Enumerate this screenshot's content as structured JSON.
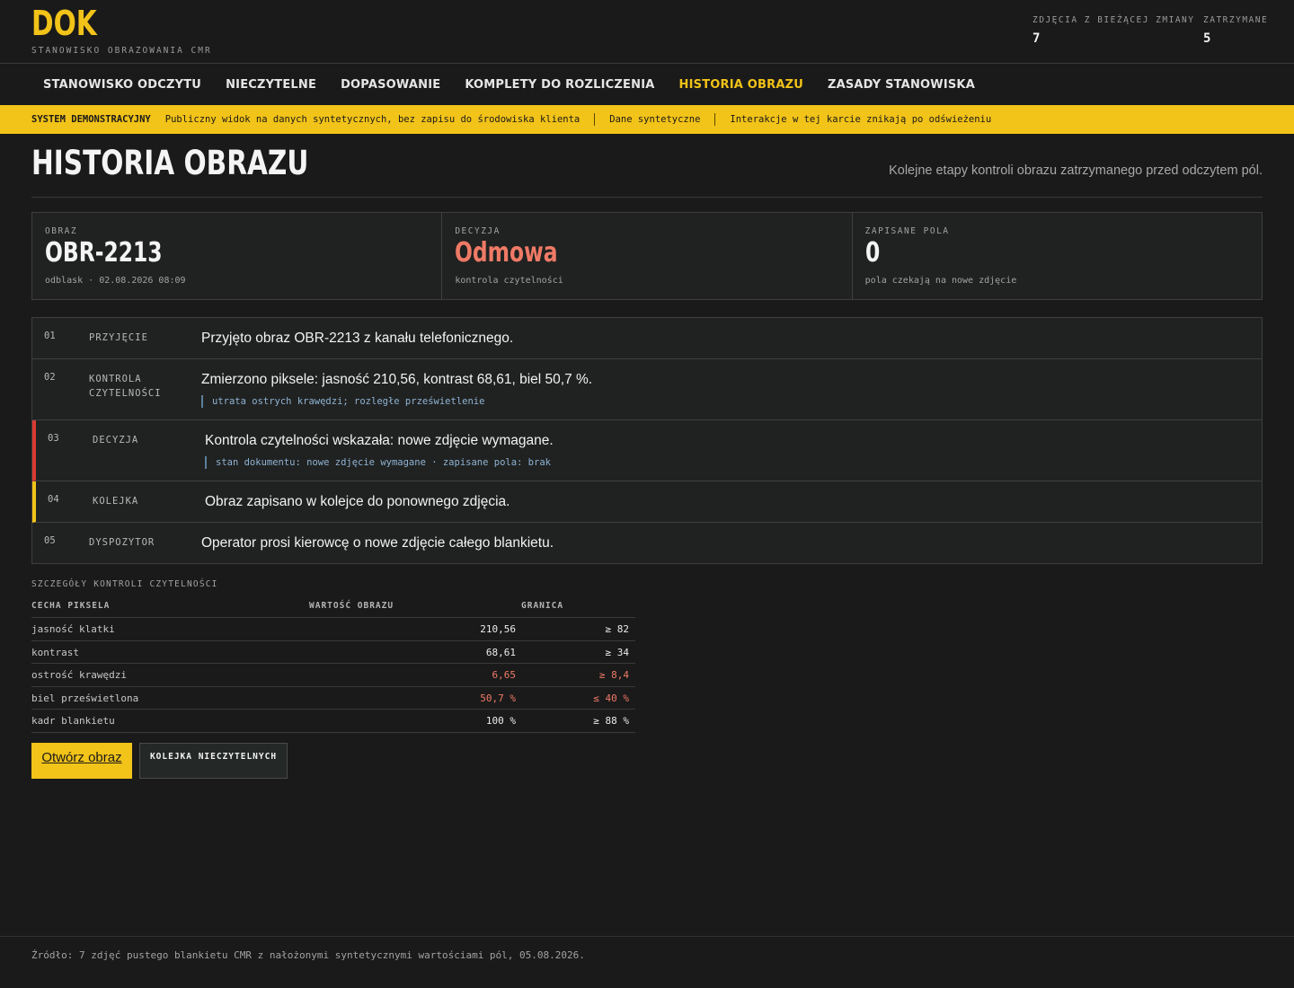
{
  "brand": {
    "name": "DOK",
    "subtitle": "STANOWISKO OBRAZOWANIA CMR"
  },
  "stats": [
    {
      "label": "ZDJĘCIA Z BIEŻĄCEJ ZMIANY",
      "value": "7"
    },
    {
      "label": "ZATRZYMANE",
      "value": "5"
    }
  ],
  "nav": {
    "items": [
      {
        "label": "STANOWISKO ODCZYTU",
        "active": false
      },
      {
        "label": "NIECZYTELNE",
        "active": false
      },
      {
        "label": "DOPASOWANIE",
        "active": false
      },
      {
        "label": "KOMPLETY DO ROZLICZENIA",
        "active": false
      },
      {
        "label": "HISTORIA OBRAZU",
        "active": true
      },
      {
        "label": "ZASADY STANOWISKA",
        "active": false
      }
    ]
  },
  "banner": {
    "tag": "SYSTEM DEMONSTRACYJNY",
    "message": "Publiczny widok na danych syntetycznych, bez zapisu do środowiska klienta",
    "data_note": "Dane syntetyczne",
    "interaction_note": "Interakcje w tej karcie znikają po odświeżeniu"
  },
  "page": {
    "title": "HISTORIA OBRAZU",
    "subtitle": "Kolejne etapy kontroli obrazu zatrzymanego przed odczytem pól."
  },
  "summary": [
    {
      "label": "OBRAZ",
      "value": "OBR-2213",
      "note": "odblask · 02.08.2026 08:09"
    },
    {
      "label": "DECYZJA",
      "value": "Odmowa",
      "note": "kontrola czytelności"
    },
    {
      "label": "ZAPISANE POLA",
      "value": "0",
      "note": "pola czekają na nowe zdjęcie"
    }
  ],
  "timeline": [
    {
      "num": "01",
      "phase": "PRZYJĘCIE",
      "text": "Przyjęto obraz OBR-2213 z kanału telefonicznego.",
      "detail": ""
    },
    {
      "num": "02",
      "phase": "KONTROLA CZYTELNOŚCI",
      "text": "Zmierzono piksele: jasność 210,56, kontrast 68,61, biel 50,7 %.",
      "detail": "utrata ostrych krawędzi; rozległe prześwietlenie"
    },
    {
      "num": "03",
      "phase": "DECYZJA",
      "text": "Kontrola czytelności wskazała: nowe zdjęcie wymagane.",
      "detail": "stan dokumentu: nowe zdjęcie wymagane · zapisane pola: brak"
    },
    {
      "num": "04",
      "phase": "KOLEJKA",
      "text": "Obraz zapisano w kolejce do ponownego zdjęcia.",
      "detail": ""
    },
    {
      "num": "05",
      "phase": "DYSPOZYTOR",
      "text": "Operator prosi kierowcę o nowe zdjęcie całego blankietu.",
      "detail": ""
    }
  ],
  "details": {
    "caption": "SZCZEGÓŁY KONTROLI CZYTELNOŚCI",
    "headers": [
      "CECHA PIKSELA",
      "WARTOŚĆ OBRAZU",
      "GRANICA"
    ],
    "rows": [
      {
        "feature": "jasność klatki",
        "value": "210,56",
        "limit": "≥ 82"
      },
      {
        "feature": "kontrast",
        "value": "68,61",
        "limit": "≥ 34"
      },
      {
        "feature": "ostrość krawędzi",
        "value": "6,65",
        "limit": "≥ 8,4"
      },
      {
        "feature": "biel prześwietlona",
        "value": "50,7 %",
        "limit": "≤ 40 %"
      },
      {
        "feature": "kadr blankietu",
        "value": "100 %",
        "limit": "≥ 88 %"
      }
    ]
  },
  "actions": {
    "open_image": "Otwórz obraz",
    "illegible_queue": "KOLEJKA NIECZYTELNYCH"
  },
  "footer": {
    "source": "Źródło: 7 zdjęć pustego blankietu CMR z nałożonymi syntetycznymi wartościami pól, 05.08.2026."
  },
  "colors": {
    "accent": "#f2c318",
    "fail": "#ef7a66",
    "decision_bar": "#d83a33",
    "detail": "#8fb3d4"
  }
}
